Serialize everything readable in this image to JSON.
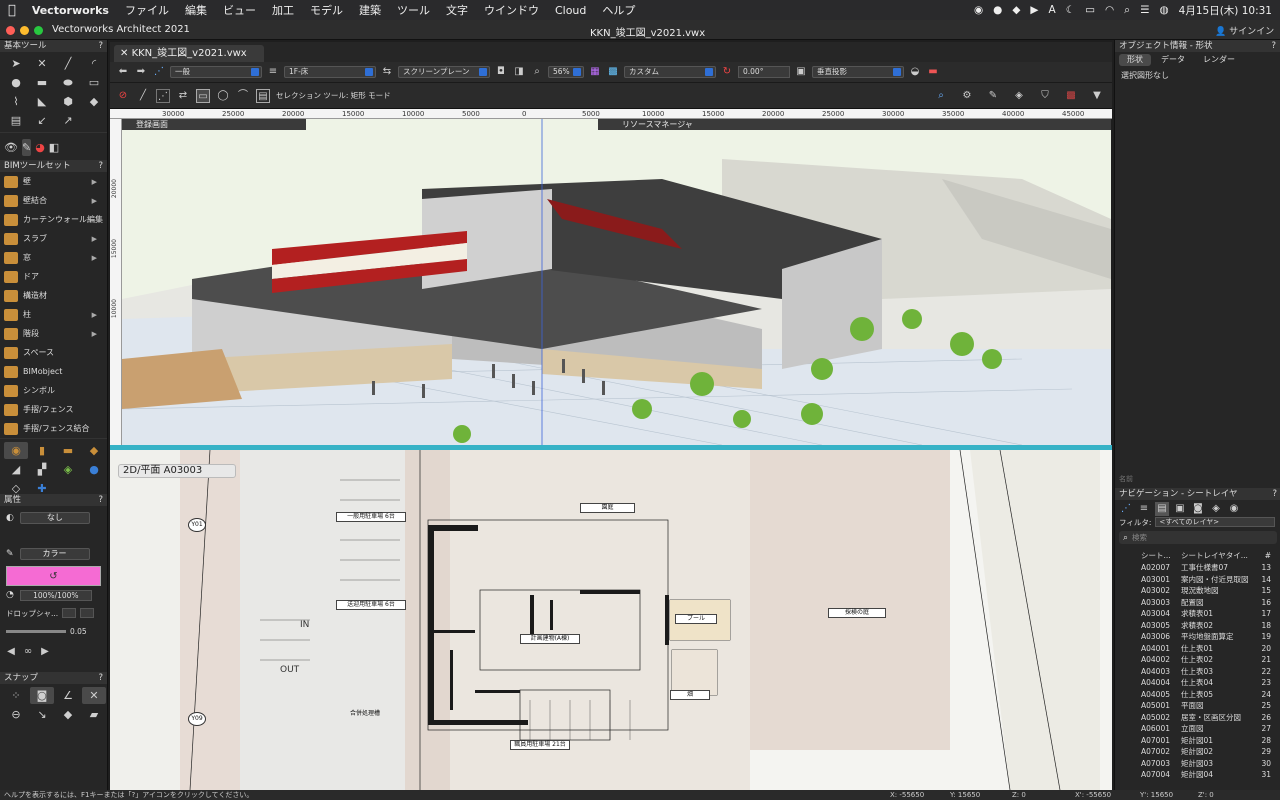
{
  "menubar": {
    "apple": "",
    "app": "Vectorworks",
    "items": [
      "ファイル",
      "編集",
      "ビュー",
      "加工",
      "モデル",
      "建築",
      "ツール",
      "文字",
      "ウインドウ",
      "Cloud",
      "ヘルプ"
    ],
    "clock": "4月15日(木)  10:31"
  },
  "window": {
    "app_title": "Vectorworks Architect 2021",
    "doc_title": "KKN_竣工図_v2021.vwx",
    "tab": "KKN_竣工図_v2021.vwx"
  },
  "left": {
    "basic_tools": "基本ツール",
    "bim_title": "BIMツールセット",
    "bim_items": [
      {
        "label": "壁",
        "arrow": true
      },
      {
        "label": "壁結合",
        "arrow": true
      },
      {
        "label": "カーテンウォール編集",
        "arrow": false
      },
      {
        "label": "スラブ",
        "arrow": true
      },
      {
        "label": "窓",
        "arrow": true
      },
      {
        "label": "ドア",
        "arrow": false
      },
      {
        "label": "構造材",
        "arrow": false
      },
      {
        "label": "柱",
        "arrow": true
      },
      {
        "label": "階段",
        "arrow": true
      },
      {
        "label": "スペース",
        "arrow": false
      },
      {
        "label": "BIMobject",
        "arrow": false
      },
      {
        "label": "シンボル",
        "arrow": false
      },
      {
        "label": "手摺/フェンス",
        "arrow": false
      },
      {
        "label": "手摺/フェンス結合",
        "arrow": false
      }
    ],
    "attr_title": "属性",
    "fill_label": "なし",
    "pen_label": "カラー",
    "opacity": "100%/100%",
    "drop_shadow": "ドロップシャ...",
    "line_weight": "0.05",
    "snap_title": "スナップ"
  },
  "toolbar1": {
    "class": "一般",
    "layer": "1F-床",
    "plane": "スクリーンプレーン",
    "zoom": "56%",
    "render": "カスタム",
    "angle": "0.00°",
    "projection": "垂直投影"
  },
  "toolbar2": {
    "mode": "セレクション ツール: 矩形 モード"
  },
  "ruler": [
    "30000",
    "25000",
    "20000",
    "15000",
    "10000",
    "5000",
    "0",
    "5000",
    "10000",
    "15000",
    "20000",
    "25000",
    "30000",
    "35000",
    "40000",
    "45000"
  ],
  "vruler": [
    "20000",
    "15000",
    "10000"
  ],
  "panes": {
    "top_left": "登録画面",
    "top_right": "リソースマネージャ",
    "view2d_label": "2D/平面  A03003"
  },
  "plan_labels": [
    "一般用駐車場 6台",
    "送迎用駐車場 6台",
    "園庭",
    "プール",
    "計画建物(A棟)",
    "畑",
    "採検の庭",
    "職員用駐車場 21台",
    "合併処理槽",
    "IN",
    "OUT",
    "Y01",
    "Y09"
  ],
  "right": {
    "obj_title": "オブジェクト情報 - 形状",
    "tabs": [
      "形状",
      "データ",
      "レンダー"
    ],
    "no_selection": "選択図形なし",
    "name_label": "名前",
    "nav_title": "ナビゲーション - シートレイヤ",
    "filter": "フィルタ:",
    "filter_value": "<すべてのレイヤ>",
    "search": "検索",
    "col_headers": [
      "シート...",
      "シートレイヤタイ...",
      "#"
    ],
    "sheets": [
      {
        "id": "A02007",
        "title": "工事仕様書07",
        "num": "13"
      },
      {
        "id": "A03001",
        "title": "案内図・付近見取図",
        "num": "14"
      },
      {
        "id": "A03002",
        "title": "現況敷地図",
        "num": "15"
      },
      {
        "id": "A03003",
        "title": "配置図",
        "num": "16"
      },
      {
        "id": "A03004",
        "title": "求積表01",
        "num": "17"
      },
      {
        "id": "A03005",
        "title": "求積表02",
        "num": "18"
      },
      {
        "id": "A03006",
        "title": "平均地盤面算定",
        "num": "19"
      },
      {
        "id": "A04001",
        "title": "仕上表01",
        "num": "20"
      },
      {
        "id": "A04002",
        "title": "仕上表02",
        "num": "21"
      },
      {
        "id": "A04003",
        "title": "仕上表03",
        "num": "22"
      },
      {
        "id": "A04004",
        "title": "仕上表04",
        "num": "23"
      },
      {
        "id": "A04005",
        "title": "仕上表05",
        "num": "24"
      },
      {
        "id": "A05001",
        "title": "平面図",
        "num": "25"
      },
      {
        "id": "A05002",
        "title": "居室・区画区分図",
        "num": "26"
      },
      {
        "id": "A06001",
        "title": "立面図",
        "num": "27"
      },
      {
        "id": "A07001",
        "title": "矩計図01",
        "num": "28"
      },
      {
        "id": "A07002",
        "title": "矩計図02",
        "num": "29"
      },
      {
        "id": "A07003",
        "title": "矩計図03",
        "num": "30"
      },
      {
        "id": "A07004",
        "title": "矩計図04",
        "num": "31"
      }
    ]
  },
  "status": {
    "help": "ヘルプを表示するには、F1キーまたは「?」アイコンをクリックしてください。",
    "x": "X:    -55650",
    "y": "Y:    15650",
    "z": "Z:    0",
    "xp": "X':   -55650",
    "yp": "Y':   15650",
    "zp": "Z':   0"
  }
}
